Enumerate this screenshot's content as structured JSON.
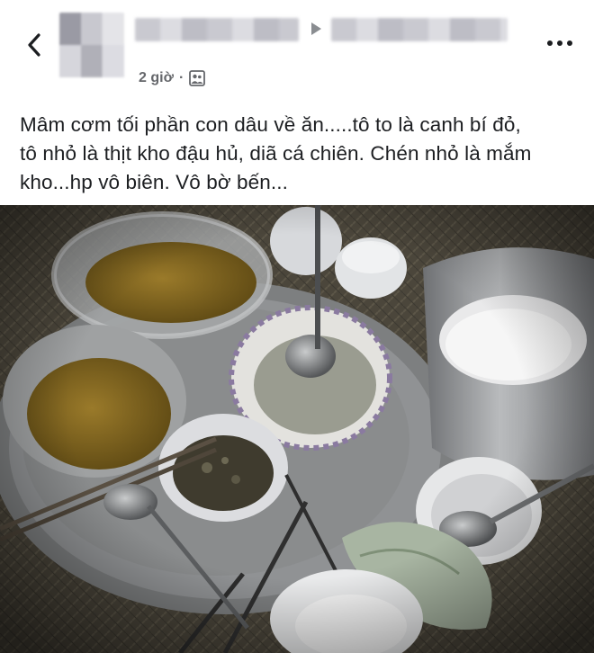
{
  "header": {
    "back_icon": "chevron-left-icon",
    "time_label": "2 giờ",
    "separator": "·",
    "audience_icon": "friends-audience-icon",
    "more_icon": "more-horizontal-icon",
    "arrow_icon": "triangle-right-icon"
  },
  "post": {
    "text": "Mâm cơm tối phần con dâu về ăn.....tô to là canh bí đỏ,\ntô nhỏ là thịt kho đậu hủ, diã cá chiên. Chén nhỏ là mắm\nkho...hp vô biên. Vô bờ bến..."
  },
  "photo": {
    "subject": "meal-tray-photo"
  },
  "colors": {
    "meta_gray": "#65676b",
    "text": "#1c1e21",
    "photo_floor": "#4a4538"
  }
}
